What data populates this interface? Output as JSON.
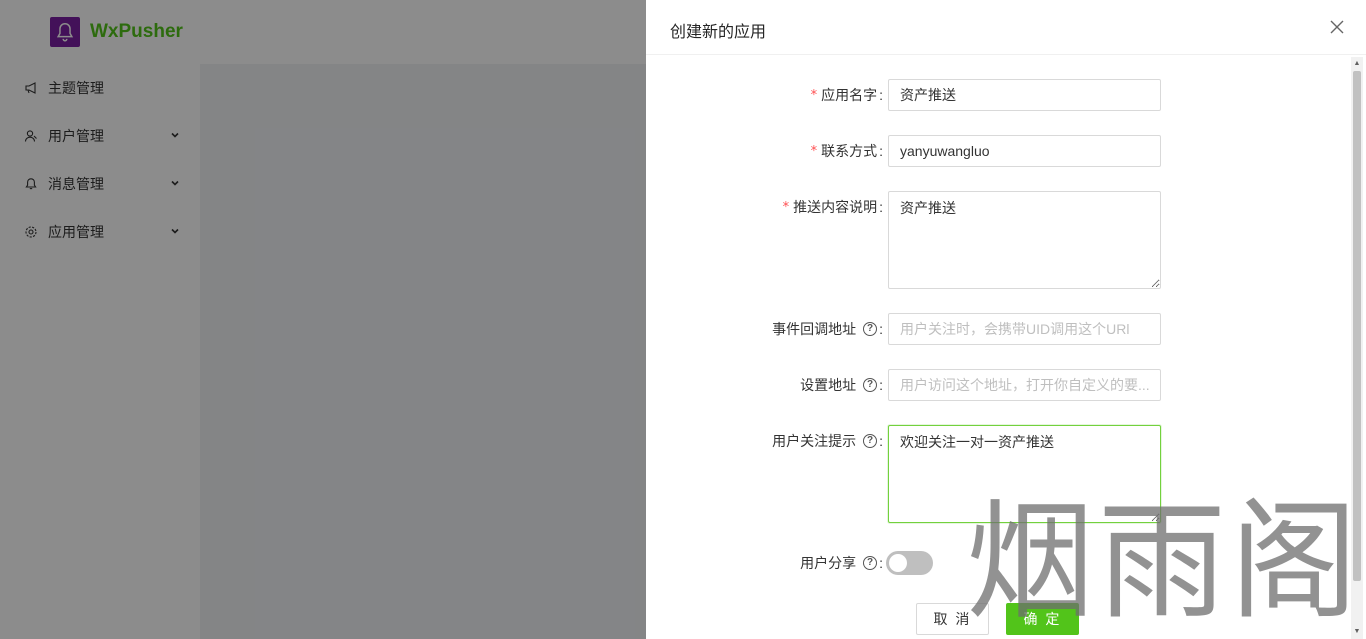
{
  "app": {
    "brand": "WxPusher",
    "menu": [
      {
        "label": "主题管理",
        "icon": "megaphone-icon",
        "has_submenu": false
      },
      {
        "label": "用户管理",
        "icon": "users-icon",
        "has_submenu": true
      },
      {
        "label": "消息管理",
        "icon": "bell-icon",
        "has_submenu": true
      },
      {
        "label": "应用管理",
        "icon": "gear-icon",
        "has_submenu": true
      }
    ]
  },
  "drawer": {
    "title": "创建新的应用",
    "fields": {
      "app_name": {
        "label": "应用名字",
        "value": "资产推送",
        "required": true
      },
      "contact": {
        "label": "联系方式",
        "value": "yanyuwangluo",
        "required": true
      },
      "description": {
        "label": "推送内容说明",
        "value": "资产推送",
        "required": true
      },
      "callback_url": {
        "label": "事件回调地址",
        "value": "",
        "placeholder": "用户关注时，会携带UID调用这个URl"
      },
      "settings_url": {
        "label": "设置地址",
        "value": "",
        "placeholder": "用户访问这个地址，打开你自定义的要..."
      },
      "follow_tip": {
        "label": "用户关注提示",
        "value": "欢迎关注一对一资产推送"
      },
      "share": {
        "label": "用户分享",
        "enabled": false
      }
    },
    "colon": ":",
    "buttons": {
      "cancel": "取 消",
      "ok": "确 定"
    }
  },
  "watermark": "烟雨阁",
  "colors": {
    "brand_green": "#52c41a",
    "logo_purple": "#7b1fa2",
    "required_red": "#ff4d4f"
  }
}
